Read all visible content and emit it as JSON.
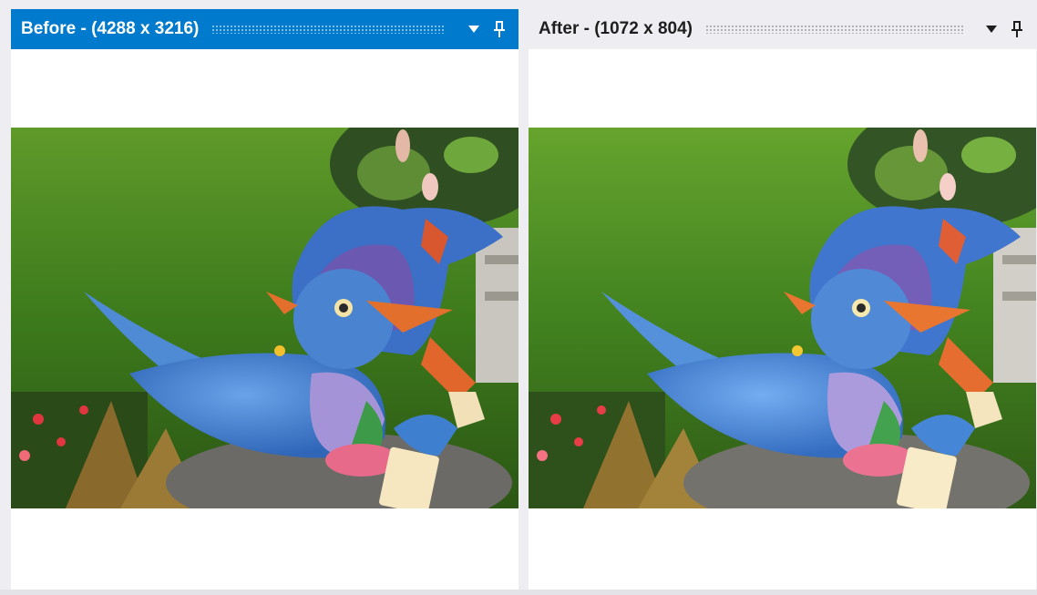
{
  "panels": {
    "before": {
      "title": "Before - (4288 x 3216)",
      "active": true
    },
    "after": {
      "title": "After - (1072 x 804)",
      "active": false
    }
  },
  "icons": {
    "menu": "chevron-down-icon",
    "pin": "pin-icon"
  },
  "colors": {
    "active_tab": "#007acc",
    "inactive_tab": "#eeeef2",
    "background": "#ffffff"
  }
}
